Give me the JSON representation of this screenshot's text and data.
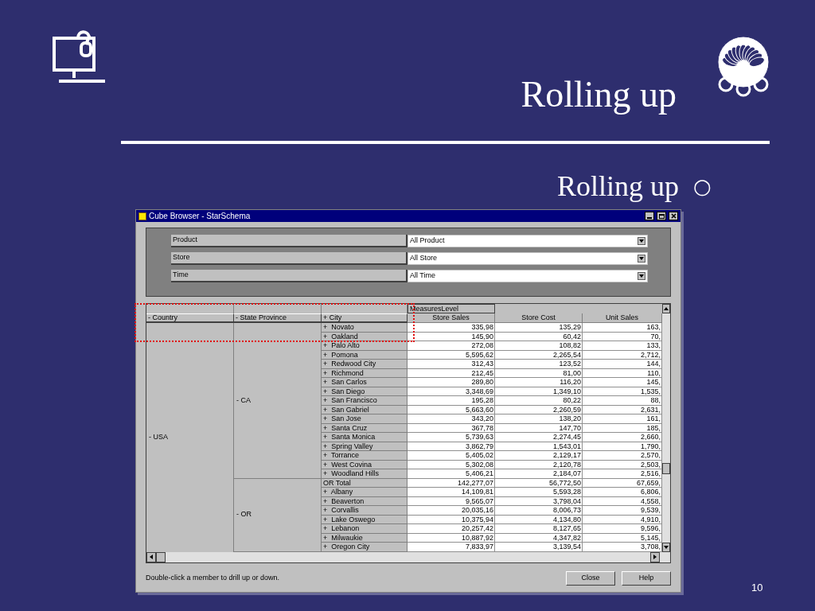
{
  "slide": {
    "title": "Rolling up",
    "bullet": "Rolling up",
    "bullet_marker": "○",
    "page_number": "10"
  },
  "window": {
    "title": "Cube Browser - StarSchema",
    "filters": [
      {
        "label": "Product",
        "value": "All Product"
      },
      {
        "label": "Store",
        "value": "All Store"
      },
      {
        "label": "Time",
        "value": "All Time"
      }
    ],
    "measures_level": "MeasuresLevel",
    "row_headers": [
      "- Country",
      "- State Province",
      "+ City"
    ],
    "columns": [
      "Store Sales",
      "Store Cost",
      "Unit Sales"
    ],
    "country": "-  USA",
    "states": [
      {
        "label": "-  CA",
        "rows": [
          {
            "city": "+  Novato",
            "values": [
              "335,98",
              "135,29",
              "163,"
            ]
          },
          {
            "city": "+  Oakland",
            "values": [
              "145,90",
              "60,42",
              "70,"
            ]
          },
          {
            "city": "+  Palo Alto",
            "values": [
              "272,08",
              "108,82",
              "133,"
            ]
          },
          {
            "city": "+  Pomona",
            "values": [
              "5,595,62",
              "2,265,54",
              "2,712,"
            ]
          },
          {
            "city": "+  Redwood City",
            "values": [
              "312,43",
              "123,52",
              "144,"
            ]
          },
          {
            "city": "+  Richmond",
            "values": [
              "212,45",
              "81,00",
              "110,"
            ]
          },
          {
            "city": "+  San Carlos",
            "values": [
              "289,80",
              "116,20",
              "145,"
            ]
          },
          {
            "city": "+  San Diego",
            "values": [
              "3,348,69",
              "1,349,10",
              "1,535,"
            ]
          },
          {
            "city": "+  San Francisco",
            "values": [
              "195,28",
              "80,22",
              "88,"
            ]
          },
          {
            "city": "+  San Gabriel",
            "values": [
              "5,663,60",
              "2,260,59",
              "2,631,"
            ]
          },
          {
            "city": "+  San Jose",
            "values": [
              "343,20",
              "138,20",
              "161,"
            ]
          },
          {
            "city": "+  Santa Cruz",
            "values": [
              "367,78",
              "147,70",
              "185,"
            ]
          },
          {
            "city": "+  Santa Monica",
            "values": [
              "5,739,63",
              "2,274,45",
              "2,660,"
            ]
          },
          {
            "city": "+  Spring Valley",
            "values": [
              "3,862,79",
              "1,543,01",
              "1,790,"
            ]
          },
          {
            "city": "+  Torrance",
            "values": [
              "5,405,02",
              "2,129,17",
              "2,570,"
            ]
          },
          {
            "city": "+  West Covina",
            "values": [
              "5,302,08",
              "2,120,78",
              "2,503,"
            ]
          },
          {
            "city": "+  Woodland Hills",
            "values": [
              "5,406,21",
              "2,184,07",
              "2,516,"
            ]
          }
        ]
      },
      {
        "label": "-  OR",
        "rows": [
          {
            "city": "OR Total",
            "values": [
              "142,277,07",
              "56,772,50",
              "67,659,"
            ]
          },
          {
            "city": "+  Albany",
            "values": [
              "14,109,81",
              "5,593,28",
              "6,806,"
            ]
          },
          {
            "city": "+  Beaverton",
            "values": [
              "9,565,07",
              "3,798,04",
              "4,558,"
            ]
          },
          {
            "city": "+  Corvallis",
            "values": [
              "20,035,16",
              "8,006,73",
              "9,539,"
            ]
          },
          {
            "city": "+  Lake Oswego",
            "values": [
              "10,375,94",
              "4,134,80",
              "4,910,"
            ]
          },
          {
            "city": "+  Lebanon",
            "values": [
              "20,257,42",
              "8,127,65",
              "9,596,"
            ]
          },
          {
            "city": "+  Milwaukie",
            "values": [
              "10,887,92",
              "4,347,82",
              "5,145,"
            ]
          },
          {
            "city": "+  Oregon City",
            "values": [
              "7,833,97",
              "3,139,54",
              "3,708,"
            ]
          }
        ]
      }
    ],
    "status": "Double-click a member to drill up or down.",
    "buttons": [
      "Close",
      "Help"
    ]
  }
}
